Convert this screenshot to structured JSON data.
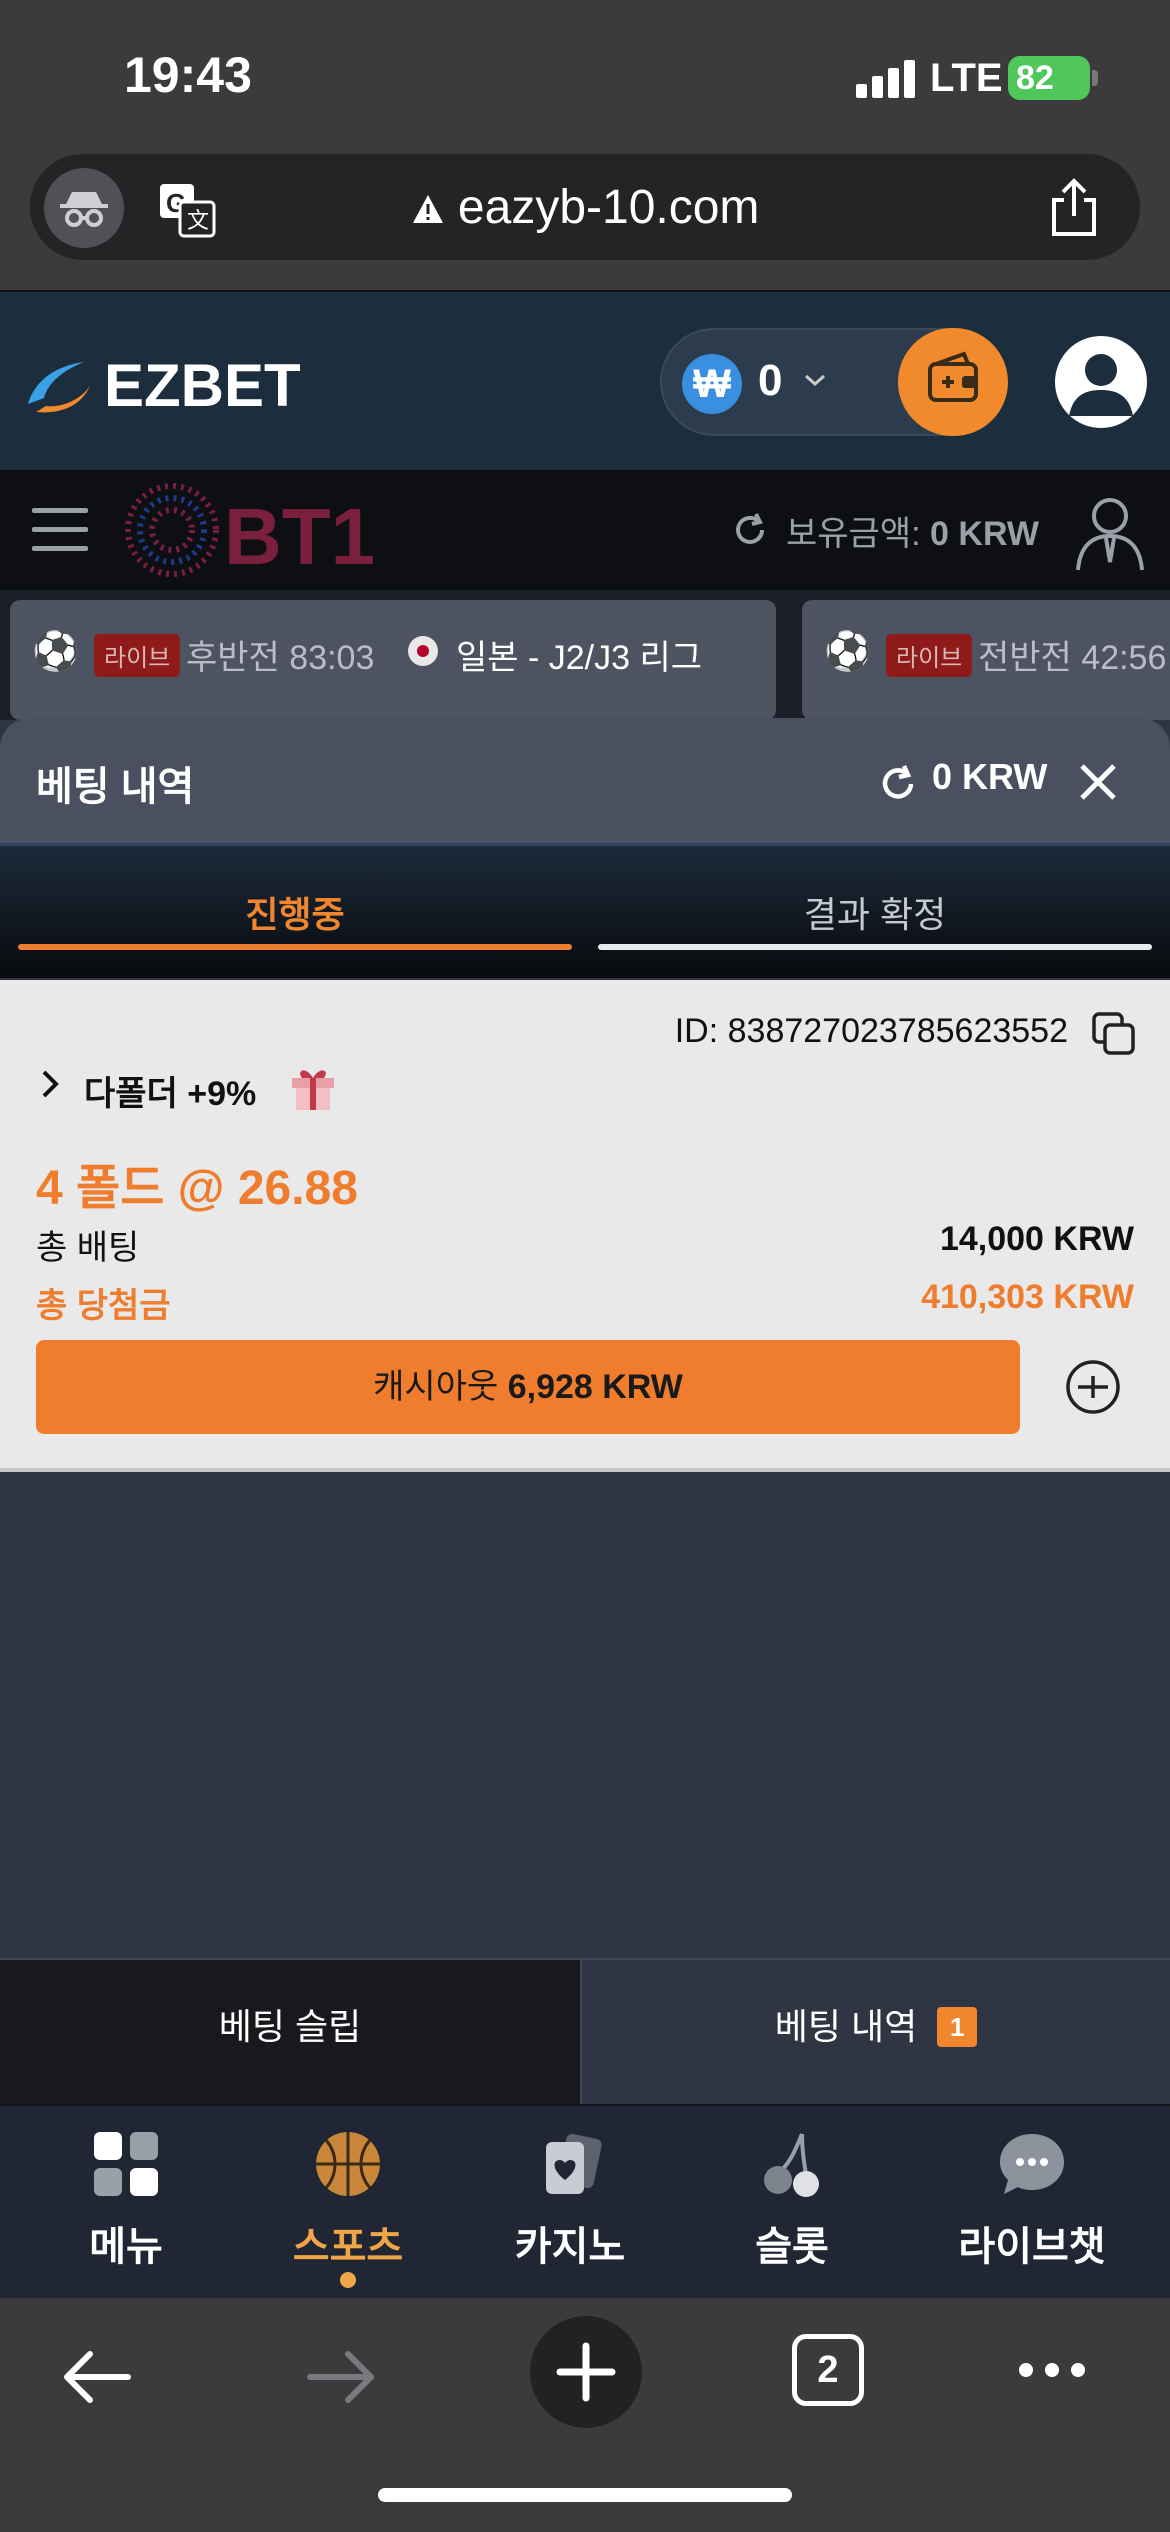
{
  "status_bar": {
    "time": "19:43",
    "network": "LTE",
    "battery": "82"
  },
  "browser": {
    "url": "eazyb-10.com",
    "tab_count": "2"
  },
  "header": {
    "logo_text": "EZBET",
    "wallet_currency_symbol": "₩",
    "wallet_amount": "0"
  },
  "sub_bar": {
    "logo_text": "BT1",
    "balance_label": "보유금액:",
    "balance_value": "0 KRW"
  },
  "live_matches": [
    {
      "badge": "라이브",
      "time": "후반전 83:03",
      "league": "일본 - J2/J3 리그"
    },
    {
      "badge": "라이브",
      "time": "전반전 42:56"
    }
  ],
  "panel": {
    "title": "베팅 내역",
    "amount": "0 KRW"
  },
  "tabs": {
    "in_progress": "진행중",
    "settled": "결과 확정"
  },
  "bet": {
    "id": "ID: 838727023785623552",
    "type": "다폴더 +9%",
    "folds": "4 폴드 @ 26.88",
    "total_bet_label": "총 배팅",
    "total_bet_value": "14,000 KRW",
    "total_win_label": "총 당첨금",
    "total_win_value": "410,303 KRW",
    "cashout_label": "캐시아웃",
    "cashout_value": "6,928 KRW"
  },
  "bottom_tabs": {
    "slip": "베팅 슬립",
    "history": "베팅 내역",
    "history_badge": "1"
  },
  "site_nav": [
    {
      "label": "메뉴",
      "icon": "grid-icon"
    },
    {
      "label": "스포츠",
      "icon": "basketball-icon",
      "active": true
    },
    {
      "label": "카지노",
      "icon": "cards-icon"
    },
    {
      "label": "슬롯",
      "icon": "cherry-icon"
    },
    {
      "label": "라이브챗",
      "icon": "chat-icon"
    }
  ],
  "colors": {
    "accent": "#ef7d2d",
    "header_bg": "#1c2e3e",
    "panel_bg": "#2f3542"
  }
}
